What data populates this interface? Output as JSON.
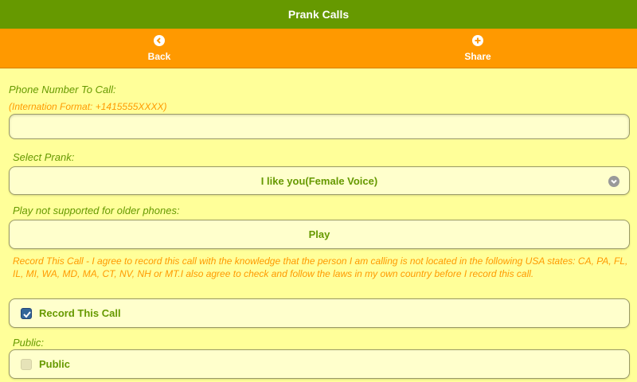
{
  "header": {
    "title": "Prank Calls"
  },
  "nav": {
    "back_label": "Back",
    "share_label": "Share"
  },
  "form": {
    "phone_label": "Phone Number To Call:",
    "phone_format_hint": "(Internation Format: +1415555XXXX)",
    "phone_value": "",
    "prank_label": "Select Prank:",
    "prank_selected": "I like you(Female Voice)",
    "play_note": "Play not supported for older phones:",
    "play_button": "Play",
    "record_note": "Record This Call - I agree to record this call with the knowledge that the person I am calling is not located in the following USA states: CA, PA, FL, IL, MI, WA, MD, MA, CT, NV, NH or MT.I also agree to check and follow the laws in my own country before I record this call.",
    "record_checkbox_label": "Record This Call",
    "record_checked": true,
    "public_label": "Public:",
    "public_checkbox_label": "Public",
    "public_checked": false
  },
  "colors": {
    "header_bg": "#669900",
    "navbar_bg": "#ff9900",
    "page_bg": "#ffff99",
    "field_bg": "#ffffcc",
    "label_green": "#669900",
    "label_orange": "#ff9900",
    "checkbox_checked": "#336699"
  },
  "icons": {
    "back": "chevron-left-circle-icon",
    "share": "plus-circle-icon",
    "select_arrow": "chevron-down-circle-icon",
    "checked": "check-icon"
  }
}
